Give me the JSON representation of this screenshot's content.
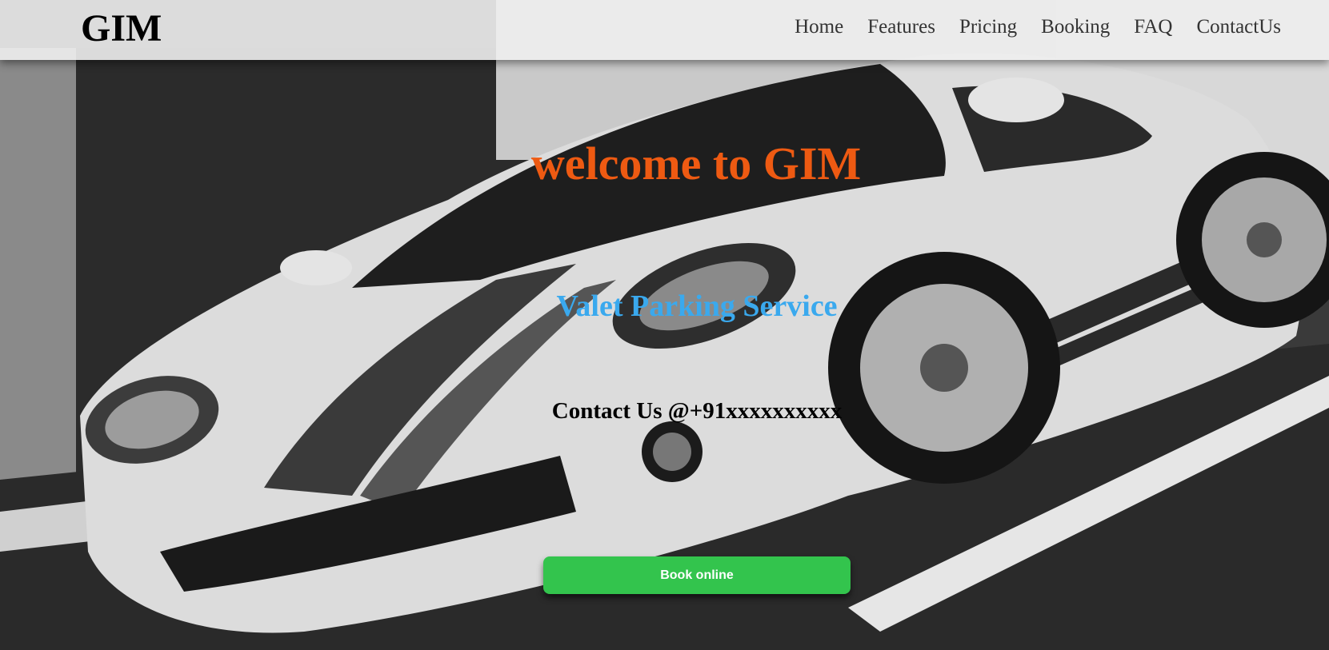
{
  "brand": {
    "name": "GIM"
  },
  "nav": {
    "items": [
      {
        "label": "Home"
      },
      {
        "label": "Features"
      },
      {
        "label": "Pricing"
      },
      {
        "label": "Booking"
      },
      {
        "label": "FAQ"
      },
      {
        "label": "ContactUs"
      }
    ]
  },
  "hero": {
    "title": "welcome to GIM",
    "subtitle": "Valet Parking Service",
    "contact": "Contact Us @+91xxxxxxxxxx",
    "cta_label": "Book online",
    "background": "black-and-white-sports-car-photo"
  },
  "colors": {
    "title": "#ee5a12",
    "subtitle": "#3aa9ee",
    "cta": "#33c44d",
    "navbar": "#eeeeee"
  }
}
